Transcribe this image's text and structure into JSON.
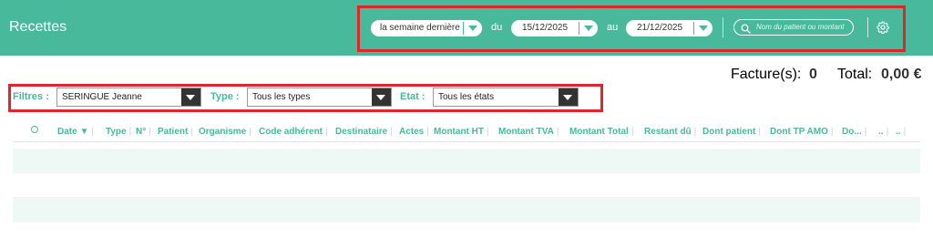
{
  "header": {
    "title": "Recettes",
    "period_label": "la semaine dernière",
    "from_label": "du",
    "from_date": "15/12/2025",
    "to_label": "au",
    "to_date": "21/12/2025",
    "search_placeholder": "Nom du patient ou montant",
    "settings_icon": "gear-icon",
    "search_icon": "search-icon"
  },
  "summary": {
    "invoices_label": "Facture(s):",
    "invoices_count": "0",
    "total_label": "Total:",
    "total_value": "0,00 €"
  },
  "filters": {
    "label": "Filtres :",
    "practitioner": "SERINGUE Jeanne",
    "type_label": "Type :",
    "type_value": "Tous les types",
    "state_label": "Etat :",
    "state_value": "Tous les états"
  },
  "table": {
    "columns": [
      "Date ▼",
      "Type",
      "N°",
      "Patient",
      "Organisme",
      "Code adhérent",
      "Destinataire",
      "Actes",
      "Montant HT",
      "Montant TVA",
      "Montant Total",
      "Restant dû",
      "Dont patient",
      "Dont TP AMO",
      "Do...",
      "..",
      ".."
    ]
  },
  "colors": {
    "accent": "#48b99a",
    "highlight_box": "#e0262c",
    "row_stripe": "#eef8f4"
  }
}
